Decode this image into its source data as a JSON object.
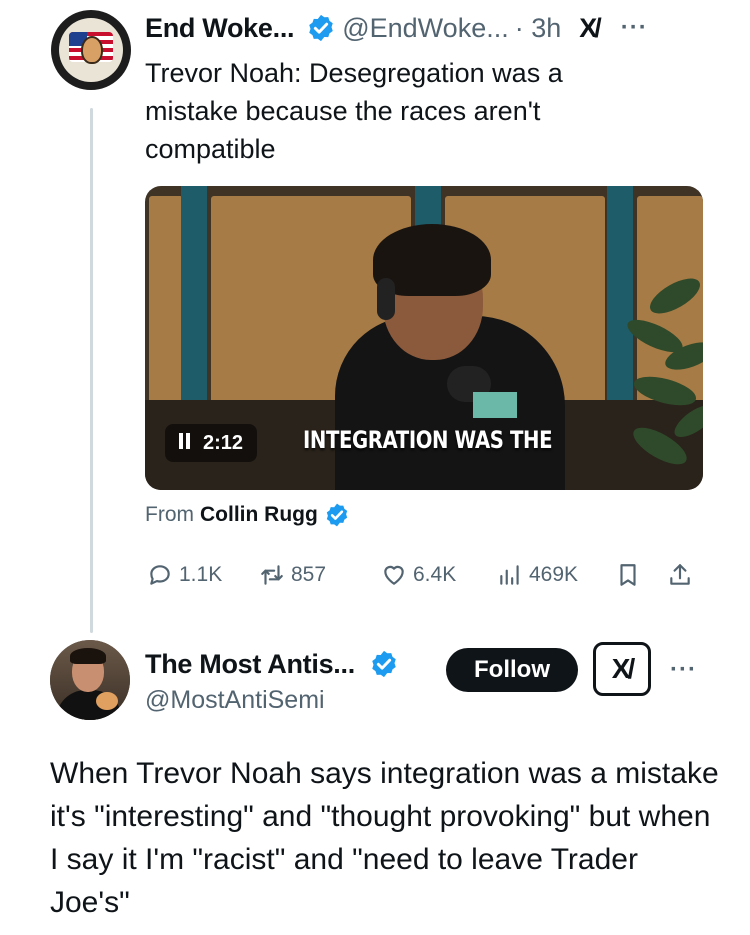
{
  "colors": {
    "accent": "#1d9bf0",
    "text": "#0f1419",
    "muted": "#536471",
    "line": "#cfd9de"
  },
  "quoted_tweet": {
    "author_name": "End Woke...",
    "handle": "@EndWoke...",
    "time": "· 3h",
    "grok_label": "X/",
    "more_label": "···",
    "text": "Trevor Noah: Desegregation was a mistake because the races aren't compatible",
    "video": {
      "duration": "2:12",
      "caption": "INTEGRATION WAS THE"
    },
    "from_prefix": "From",
    "from_name": "Collin Rugg",
    "actions": {
      "replies": "1.1K",
      "reposts": "857",
      "likes": "6.4K",
      "views": "469K"
    },
    "icons": [
      "verified-badge-icon",
      "reply-icon",
      "repost-icon",
      "like-icon",
      "views-icon",
      "bookmark-icon",
      "share-icon"
    ]
  },
  "main_tweet": {
    "author_name": "The Most Antis...",
    "handle": "@MostAntiSemi",
    "follow_label": "Follow",
    "grok_label": "X/",
    "more_label": "···",
    "text": "When Trevor Noah says integration was a mistake it's \"interesting\" and \"thought provoking\" but when I say it I'm \"racist\" and \"need to leave Trader Joe's\""
  }
}
